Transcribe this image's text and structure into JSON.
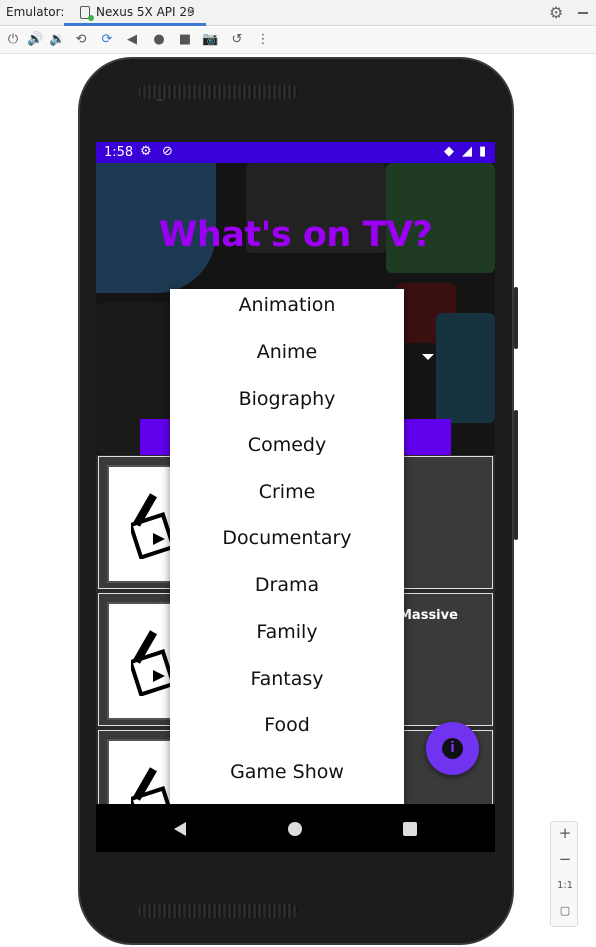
{
  "window": {
    "label": "Emulator:",
    "tab_name": "Nexus 5X API 29",
    "tab_close": "×"
  },
  "toolbar": {
    "icons": [
      "power-icon",
      "volume-up-icon",
      "volume-down-icon",
      "rotate-left-icon",
      "rotate-right-icon",
      "back-icon",
      "home-icon",
      "overview-icon",
      "screenshot-icon",
      "snapshot-icon",
      "more-icon"
    ]
  },
  "status_bar": {
    "time": "1:58"
  },
  "app": {
    "title": "What's on TV?",
    "card_partial_text": "Massive",
    "accent": "#6200ee",
    "title_color": "#9b00f5",
    "status_color": "#3a00d9"
  },
  "dropdown": {
    "items": [
      "Animation",
      "Anime",
      "Biography",
      "Comedy",
      "Crime",
      "Documentary",
      "Drama",
      "Family",
      "Fantasy",
      "Food",
      "Game Show"
    ]
  },
  "zoom": {
    "plus": "+",
    "minus": "−",
    "one_to_one": "1:1"
  }
}
